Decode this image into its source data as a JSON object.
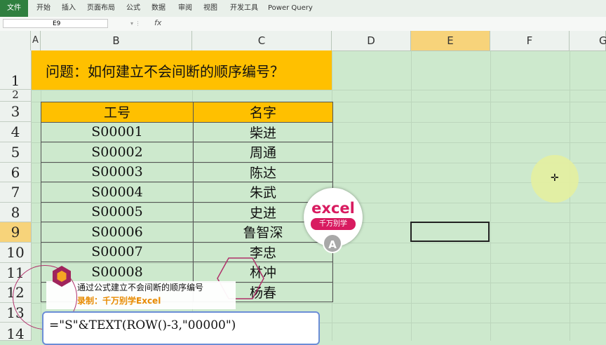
{
  "ribbon": {
    "file": "文件",
    "tabs": [
      "开始",
      "插入",
      "页面布局",
      "公式",
      "数据",
      "审阅",
      "视图",
      "开发工具",
      "Power Query"
    ]
  },
  "formula_bar": {
    "name_box": "E9",
    "fx_label": "fx"
  },
  "columns": [
    "A",
    "B",
    "C",
    "D",
    "E",
    "F",
    "G"
  ],
  "rows": [
    "1",
    "2",
    "3",
    "4",
    "5",
    "6",
    "7",
    "8",
    "9",
    "10",
    "11",
    "12",
    "13",
    "14"
  ],
  "sheet": {
    "title": "问题：如何建立不会间断的顺序编号？",
    "headers": [
      "工号",
      "名字"
    ],
    "table": [
      [
        "S00001",
        "柴进"
      ],
      [
        "S00002",
        "周通"
      ],
      [
        "S00003",
        "陈达"
      ],
      [
        "S00004",
        "朱武"
      ],
      [
        "S00005",
        "史进"
      ],
      [
        "S00006",
        "鲁智深"
      ],
      [
        "S00007",
        "李忠"
      ],
      [
        "S00008",
        "林冲"
      ],
      [
        "",
        "杨春"
      ]
    ]
  },
  "logo": {
    "brand": "excel",
    "sub": "千万别学",
    "badge": "A"
  },
  "caption": {
    "title": "通过公式建立不会间断的顺序编号",
    "subtitle": "录制：千万别学Excel"
  },
  "formula": "=\"S\"&TEXT(ROW()-3,\"00000\")",
  "colors": {
    "accent": "#ffc000",
    "sheet_bg": "#cde9cd",
    "brand": "#d81b60"
  }
}
